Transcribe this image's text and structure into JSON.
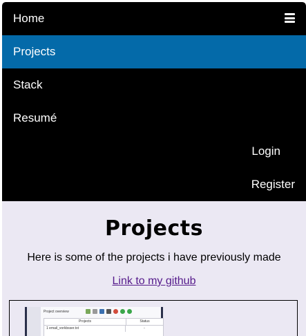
{
  "nav": {
    "home": "Home",
    "items": [
      {
        "label": "Projects",
        "active": true
      },
      {
        "label": "Stack",
        "active": false
      },
      {
        "label": "Resumé",
        "active": false
      }
    ],
    "login": "Login",
    "register": "Register",
    "menu_icon": "hamburger-menu-icon"
  },
  "main": {
    "title": "Projects",
    "intro": "Here is some of the projects i have previously made",
    "github_link": "Link to my github"
  },
  "project_card": {
    "screenshot": {
      "title": "Project overview",
      "col_projects": "Projects",
      "col_status": "Status",
      "row1_index": "1",
      "row1_name": "email_vorkbsser.txt",
      "row1_status": "-"
    }
  },
  "colors": {
    "navbar_bg": "#000000",
    "active_bg": "#046aa9",
    "page_bg": "#ebe8f3",
    "link": "#551a8b"
  }
}
